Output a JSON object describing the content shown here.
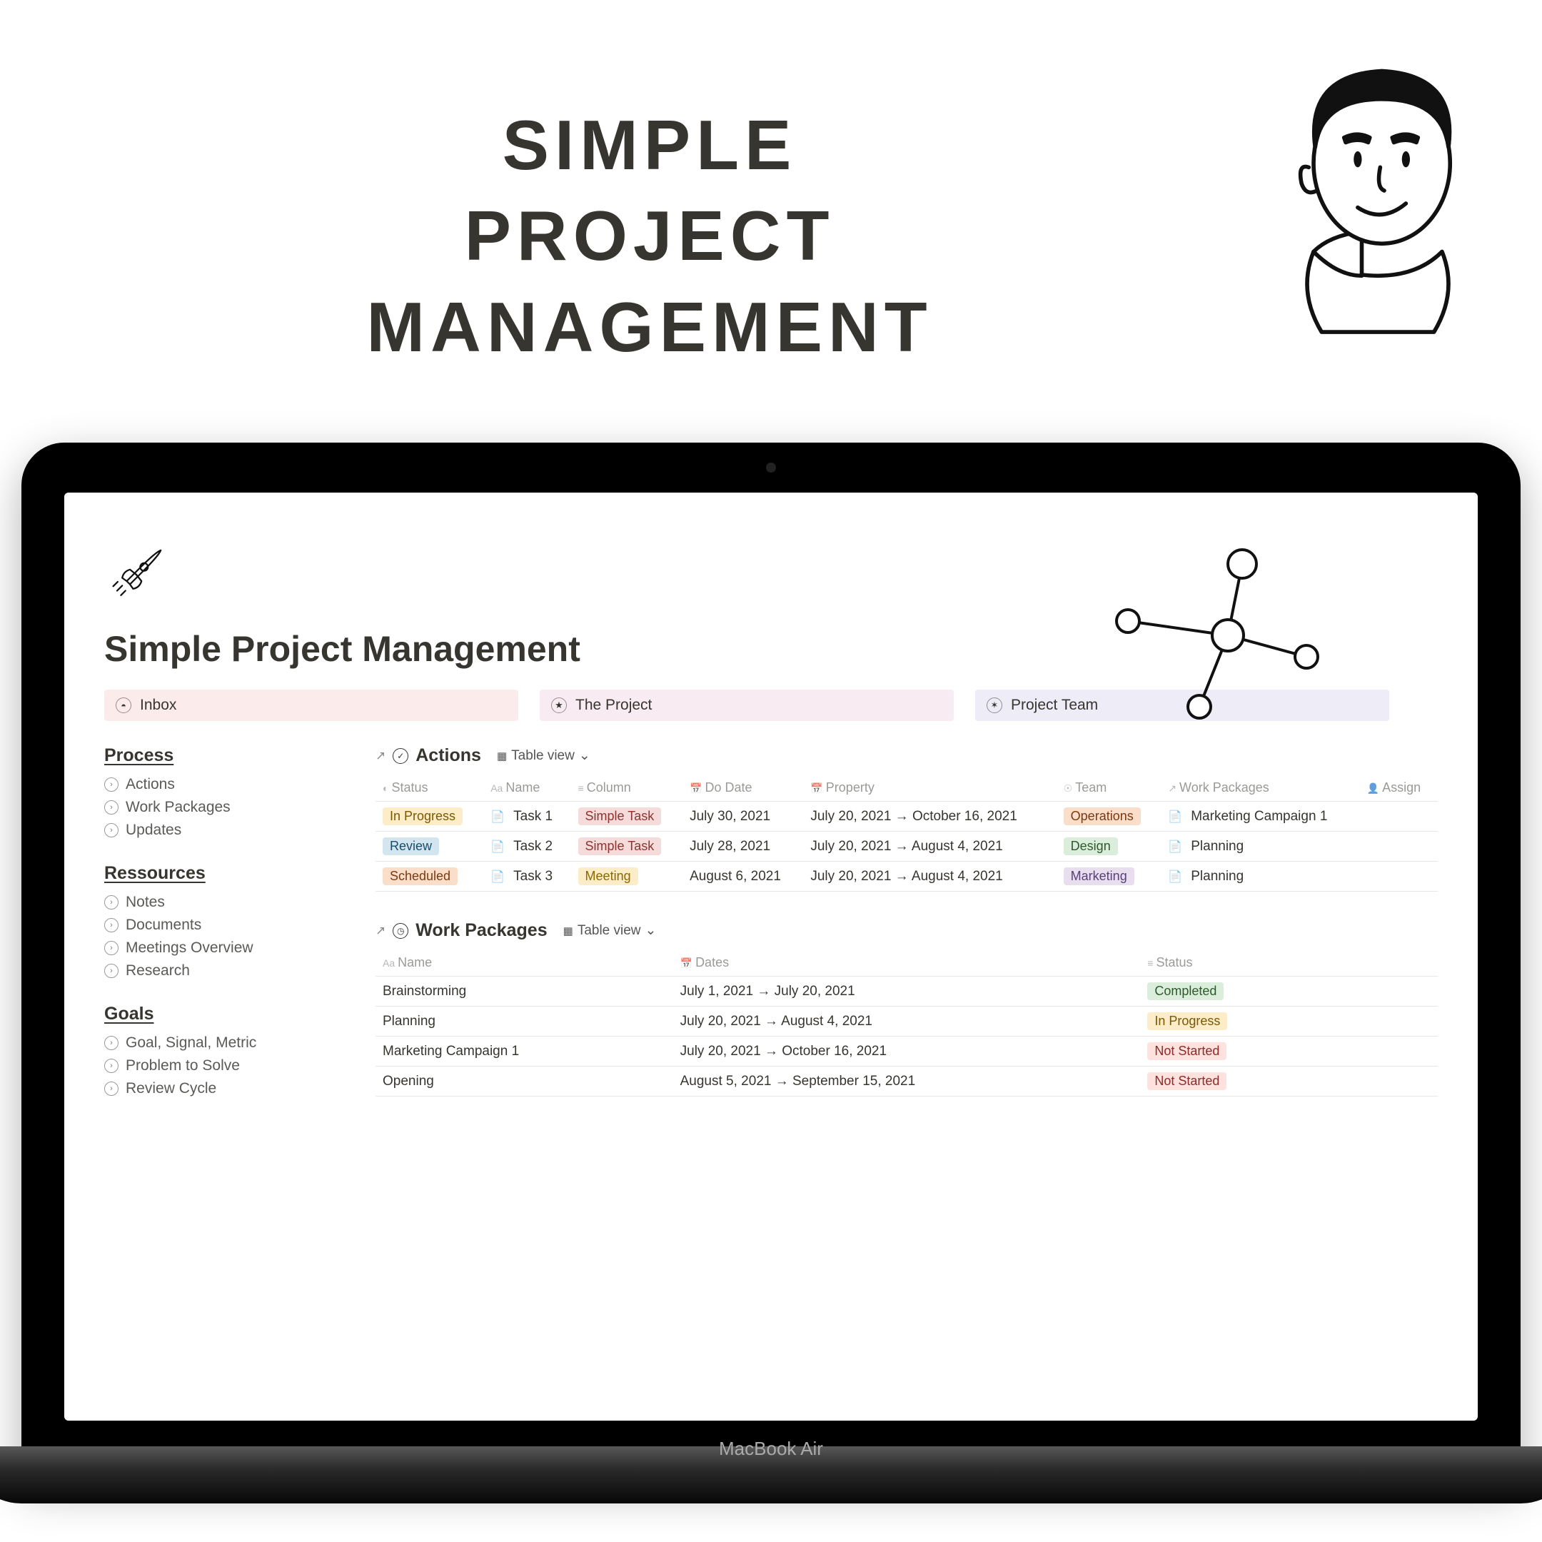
{
  "hero": {
    "title": "SIMPLE PROJECT MANAGEMENT"
  },
  "laptop_label": "MacBook Air",
  "page": {
    "title": "Simple Project Management"
  },
  "banners": {
    "inbox": "Inbox",
    "project": "The Project",
    "team": "Project Team"
  },
  "sidebar": {
    "process": {
      "heading": "Process",
      "items": [
        "Actions",
        "Work Packages",
        "Updates"
      ]
    },
    "ressources": {
      "heading": "Ressources",
      "items": [
        "Notes",
        "Documents",
        "Meetings Overview",
        "Research"
      ]
    },
    "goals": {
      "heading": "Goals",
      "items": [
        "Goal, Signal, Metric",
        "Problem to Solve",
        "Review Cycle"
      ]
    }
  },
  "actions_db": {
    "title": "Actions",
    "view": "Table view",
    "columns": [
      "Status",
      "Name",
      "Column",
      "Do Date",
      "Property",
      "Team",
      "Work Packages",
      "Assign"
    ],
    "rows": [
      {
        "status": {
          "label": "In Progress",
          "class": "tag-inprogress"
        },
        "name": "Task 1",
        "column": {
          "label": "Simple Task",
          "class": "tag-simpletask"
        },
        "dodate": "July 30, 2021",
        "property": "July 20, 2021 → October 16, 2021",
        "team": {
          "label": "Operations",
          "class": "tag-operations"
        },
        "wp": "Marketing Campaign 1"
      },
      {
        "status": {
          "label": "Review",
          "class": "tag-review"
        },
        "name": "Task 2",
        "column": {
          "label": "Simple Task",
          "class": "tag-simpletask"
        },
        "dodate": "July 28, 2021",
        "property": "July 20, 2021 → August 4, 2021",
        "team": {
          "label": "Design",
          "class": "tag-design"
        },
        "wp": "Planning"
      },
      {
        "status": {
          "label": "Scheduled",
          "class": "tag-scheduled"
        },
        "name": "Task 3",
        "column": {
          "label": "Meeting",
          "class": "tag-meeting"
        },
        "dodate": "August 6, 2021",
        "property": "July 20, 2021 → August 4, 2021",
        "team": {
          "label": "Marketing",
          "class": "tag-marketing"
        },
        "wp": "Planning"
      }
    ]
  },
  "wp_db": {
    "title": "Work Packages",
    "view": "Table view",
    "columns": [
      "Name",
      "Dates",
      "Status"
    ],
    "rows": [
      {
        "name": "Brainstorming",
        "dates": "July 1, 2021 → July 20, 2021",
        "status": {
          "label": "Completed",
          "class": "tag-completed"
        }
      },
      {
        "name": "Planning",
        "dates": "July 20, 2021 → August 4, 2021",
        "status": {
          "label": "In Progress",
          "class": "tag-inprogress"
        }
      },
      {
        "name": "Marketing Campaign 1",
        "dates": "July 20, 2021 → October 16, 2021",
        "status": {
          "label": "Not Started",
          "class": "tag-notstarted"
        }
      },
      {
        "name": "Opening",
        "dates": "August 5, 2021 → September 15, 2021",
        "status": {
          "label": "Not Started",
          "class": "tag-notstarted"
        }
      }
    ]
  }
}
